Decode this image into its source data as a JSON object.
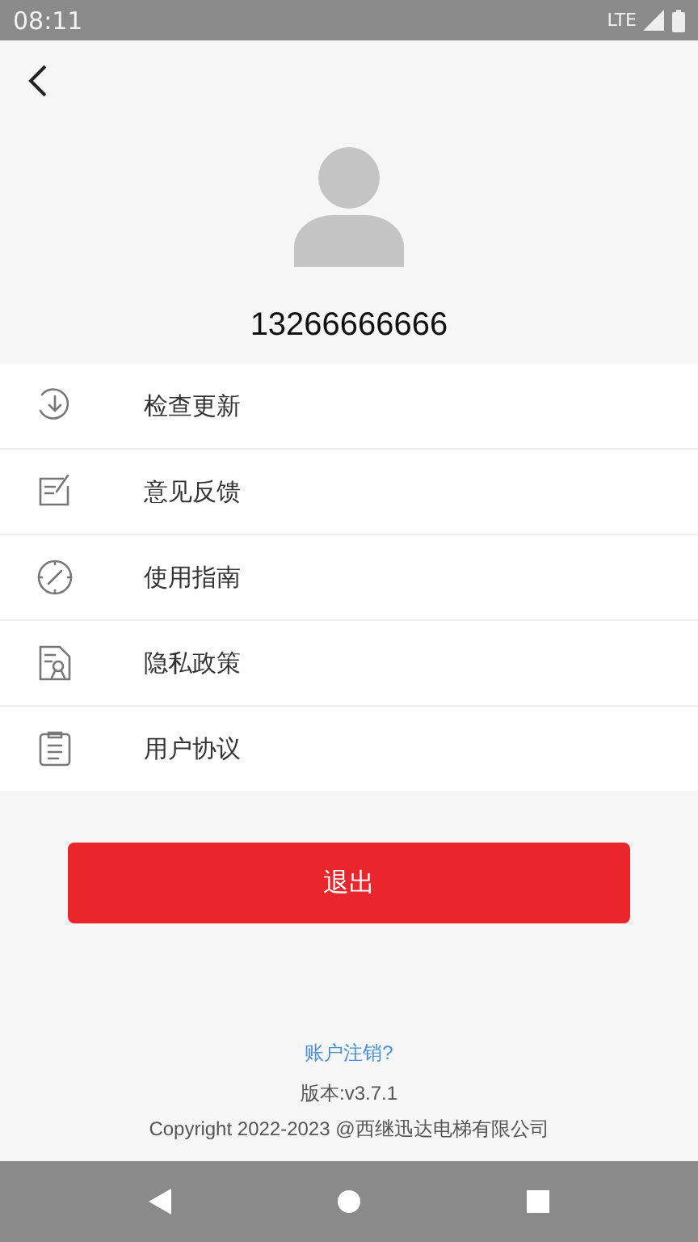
{
  "status_bar": {
    "time": "08:11",
    "network": "LTE"
  },
  "profile": {
    "phone": "13266666666"
  },
  "menu": [
    {
      "label": "检查更新"
    },
    {
      "label": "意见反馈"
    },
    {
      "label": "使用指南"
    },
    {
      "label": "隐私政策"
    },
    {
      "label": "用户协议"
    }
  ],
  "logout_button": "退出",
  "footer": {
    "cancel_account_link": "账户注销?",
    "version": "版本:v3.7.1",
    "copyright": "Copyright 2022-2023 @西继迅达电梯有限公司"
  }
}
